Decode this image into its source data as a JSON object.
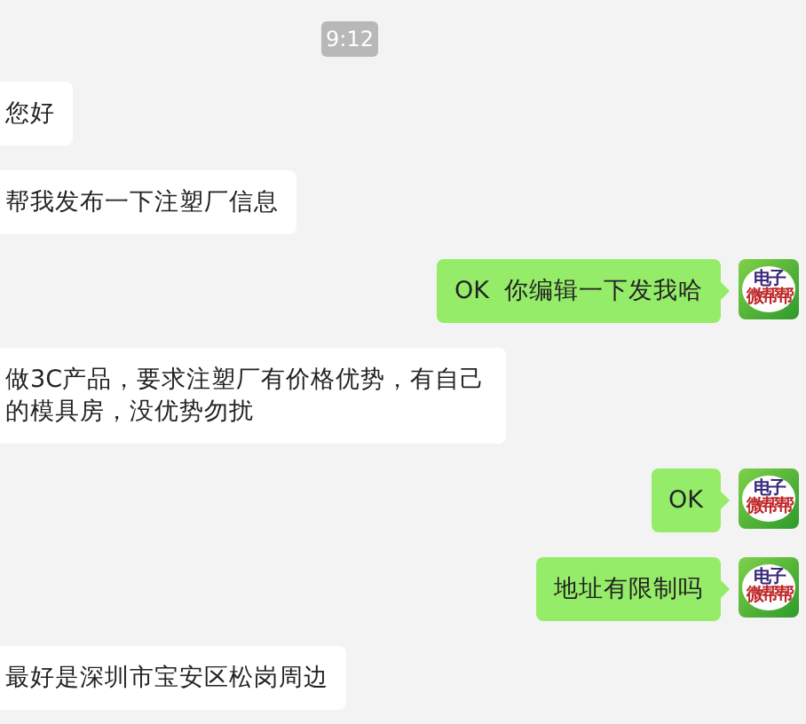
{
  "timestamp": "9:12",
  "messages": [
    {
      "kind": "incoming",
      "text": "您好"
    },
    {
      "kind": "incoming",
      "text": "帮我发布一下注塑厂信息"
    },
    {
      "kind": "outgoing",
      "text": "OK  你编辑一下发我哈",
      "avatar": [
        "电子",
        "微帮帮"
      ]
    },
    {
      "kind": "incoming",
      "text": "做3C产品，要求注塑厂有价格优势，有自己的模具房，没优势勿扰"
    },
    {
      "kind": "outgoing",
      "text": "OK",
      "avatar": [
        "电子",
        "微帮帮"
      ]
    },
    {
      "kind": "outgoing",
      "text": "地址有限制吗",
      "avatar": [
        "电子",
        "微帮帮"
      ]
    },
    {
      "kind": "incoming",
      "text": "最好是深圳市宝安区松岗周边"
    }
  ]
}
